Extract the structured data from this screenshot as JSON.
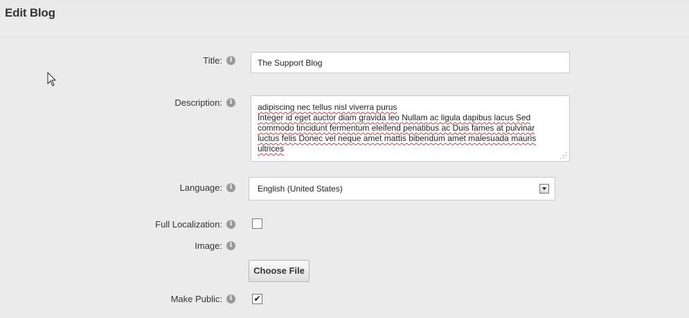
{
  "header": {
    "title": "Edit Blog"
  },
  "form": {
    "title_label": "Title:",
    "title_value": "The Support Blog",
    "description_label": "Description:",
    "description_lines": [
      "adipiscing nec tellus nisl viverra purus",
      "Integer id eget auctor diam gravida leo Nullam ac ligula dapibus lacus Sed",
      "commodo tincidunt fermentum eleifend penatibus ac Duis fames at pulvinar",
      "luctus felis Donec vel neque amet mattis bibendum amet malesuada mauris",
      "ultrices"
    ],
    "language_label": "Language:",
    "language_value": "English (United States)",
    "full_localization_label": "Full Localization:",
    "full_localization_checked": false,
    "image_label": "Image:",
    "choose_file_label": "Choose File",
    "make_public_label": "Make Public:",
    "make_public_checked": true,
    "info_glyph": "i"
  },
  "icons": {
    "info": "info-icon",
    "cursor": "mouse-pointer-icon",
    "dropdown": "chevron-down-icon",
    "check": "checkmark-icon"
  },
  "colors": {
    "background": "#ebebeb",
    "info_icon": "#9a9a9a",
    "spellcheck": "#d04040"
  }
}
